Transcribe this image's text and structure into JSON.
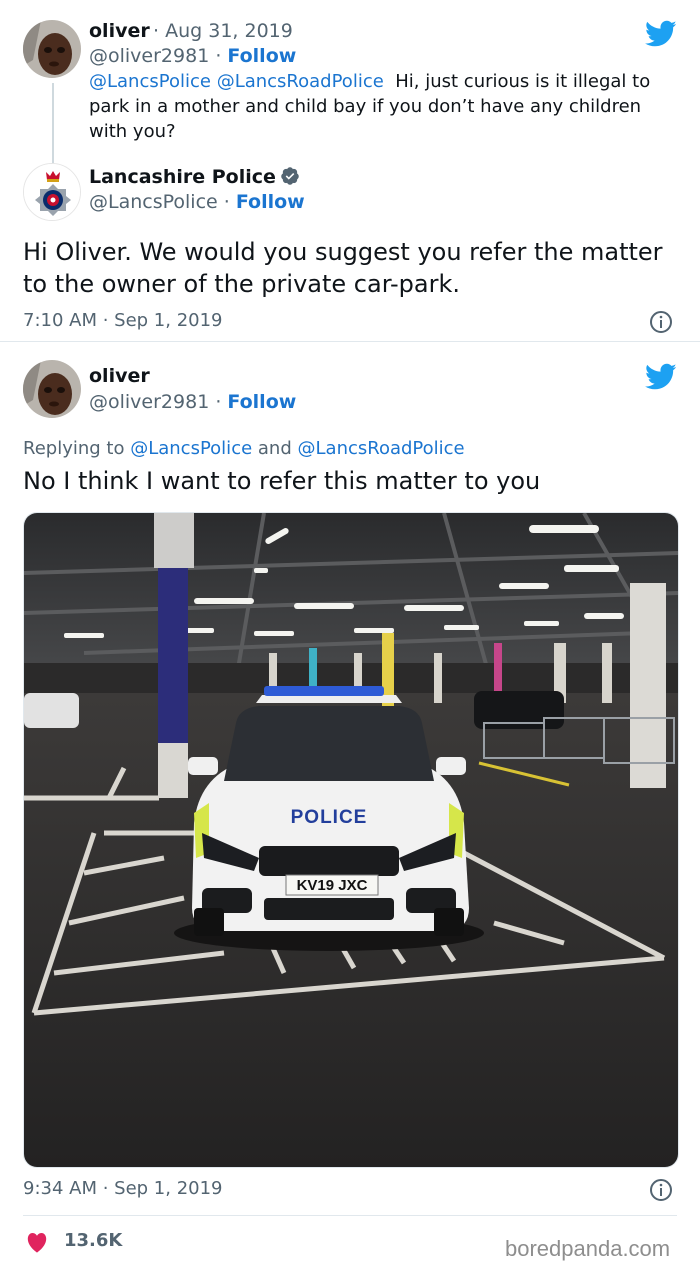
{
  "tweet1": {
    "author_name": "oliver",
    "date": "Aug 31, 2019",
    "handle": "@oliver2981",
    "follow_label": "Follow",
    "mention1": "@LancsPolice",
    "mention2": "@LancsRoadPolice",
    "text": "Hi, just curious is it illegal to park in a mother and child bay if you don’t have any children with you?"
  },
  "reply1": {
    "author_name": "Lancashire Police",
    "handle": "@LancsPolice",
    "follow_label": "Follow",
    "text": "Hi Oliver. We would you suggest you refer the matter to the owner of the private car-park.",
    "timestamp": "7:10 AM · Sep 1, 2019"
  },
  "tweet2": {
    "author_name": "oliver",
    "handle": "@oliver2981",
    "follow_label": "Follow",
    "replying_prefix": "Replying to",
    "replying_mention1": "@LancsPolice",
    "replying_and": "and",
    "replying_mention2": "@LancsRoadPolice",
    "text": "No I think I want to refer this matter to you",
    "photo": {
      "police_text": "POLICE",
      "plate": "KV19 JXC"
    },
    "timestamp": "9:34 AM · Sep 1, 2019",
    "likes": "13.6K"
  },
  "watermark": "boredpanda.com",
  "colors": {
    "link": "#1b75d0",
    "twitter_blue": "#1da1f2",
    "heart": "#e0245e",
    "muted": "#536471"
  },
  "icons": [
    "twitter-bird-icon",
    "info-icon",
    "heart-icon",
    "verified-badge-icon"
  ]
}
